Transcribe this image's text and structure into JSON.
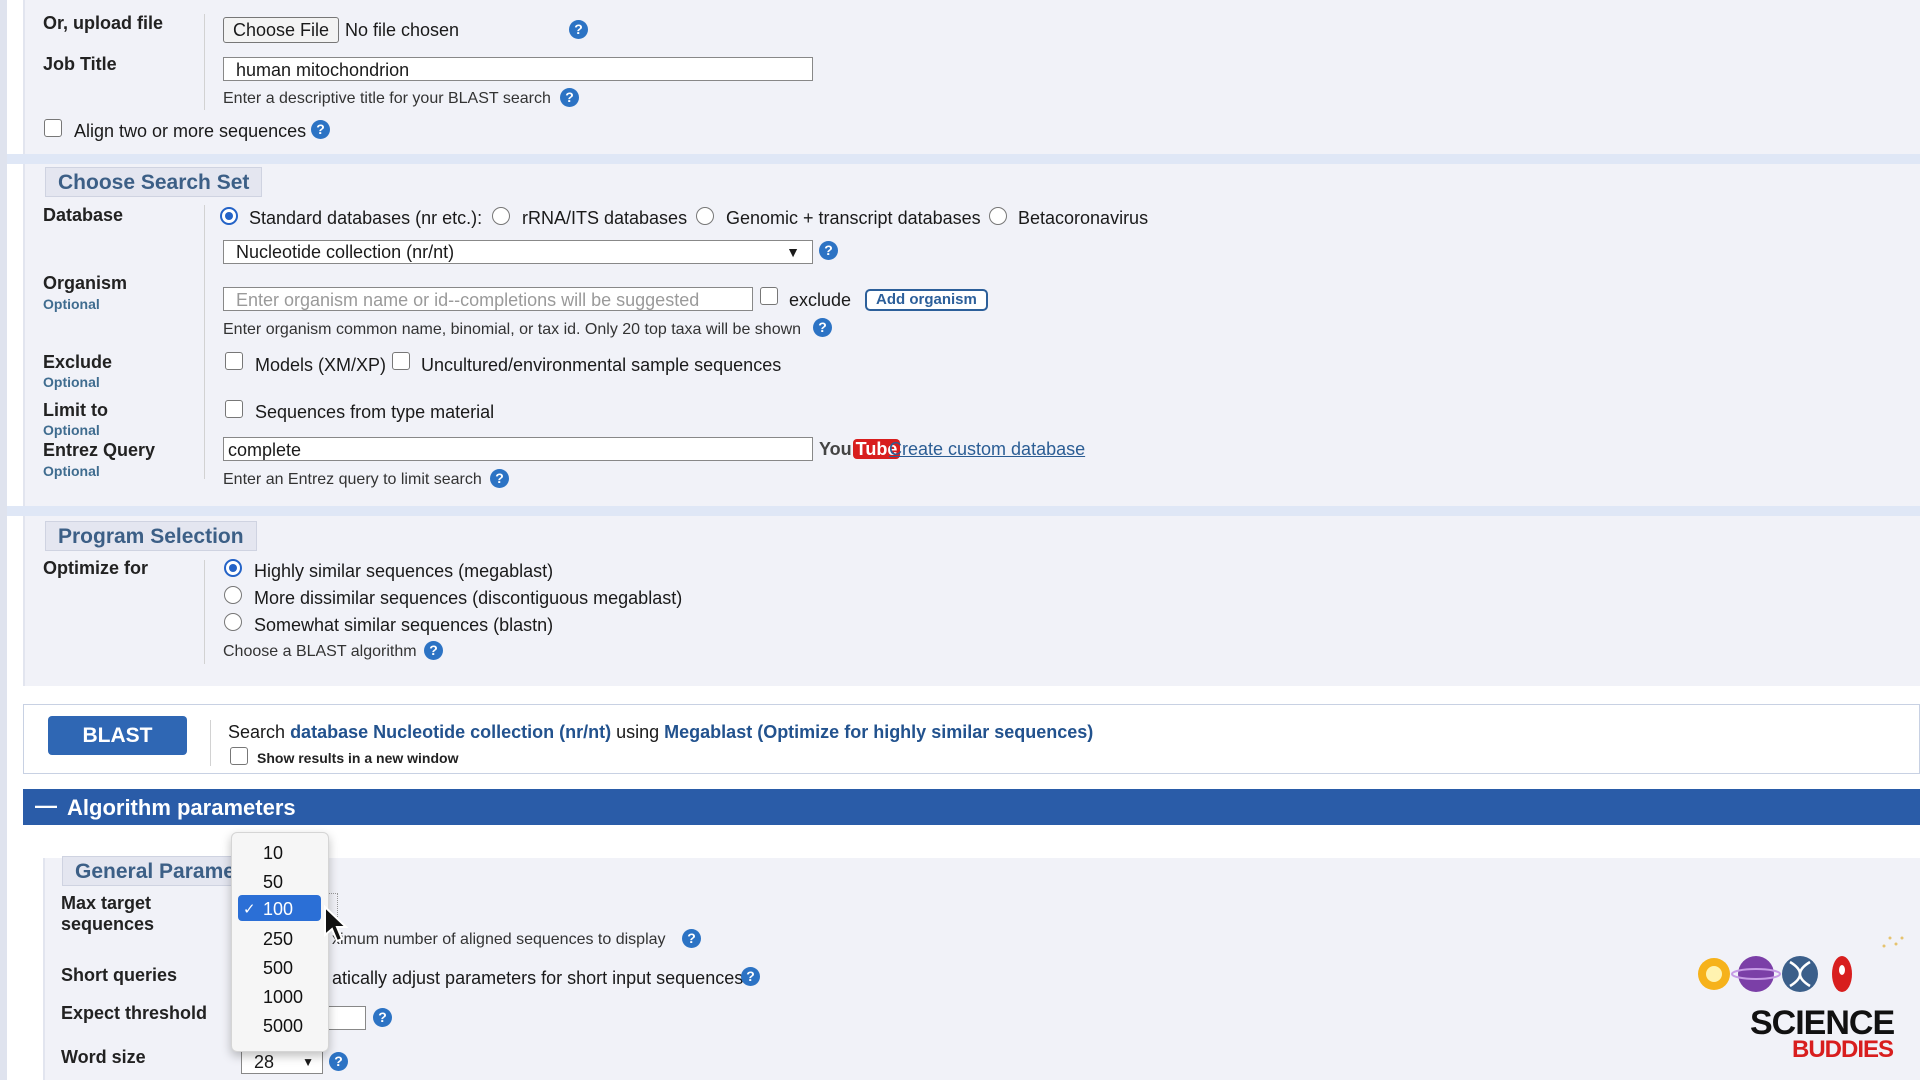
{
  "upload": {
    "label": "Or, upload file",
    "button": "Choose File",
    "status": "No file chosen"
  },
  "job_title": {
    "label": "Job Title",
    "value": "human mitochondrion",
    "hint": "Enter a descriptive title for your BLAST search"
  },
  "align": {
    "label": "Align two or more sequences"
  },
  "search_set": {
    "title": "Choose Search Set",
    "database": {
      "label": "Database",
      "options": [
        "Standard databases (nr etc.):",
        "rRNA/ITS databases",
        "Genomic + transcript databases",
        "Betacoronavirus"
      ],
      "selected": "Nucleotide collection (nr/nt)"
    },
    "organism": {
      "label": "Organism",
      "optional": "Optional",
      "placeholder": "Enter organism name or id--completions will be suggested",
      "exclude_label": "exclude",
      "add_button": "Add organism",
      "hint": "Enter organism common name, binomial, or tax id. Only 20 top taxa will be shown"
    },
    "exclude": {
      "label": "Exclude",
      "optional": "Optional",
      "models": "Models (XM/XP)",
      "uncultured": "Uncultured/environmental sample sequences"
    },
    "limit": {
      "label": "Limit to",
      "optional": "Optional",
      "type_material": "Sequences from type material"
    },
    "entrez": {
      "label": "Entrez Query",
      "optional": "Optional",
      "value": "complete",
      "youtube_you": "You",
      "youtube_tube": "Tube",
      "custom_db_link": "Create custom database",
      "hint": "Enter an Entrez query to limit search"
    }
  },
  "program": {
    "title": "Program Selection",
    "optimize_label": "Optimize for",
    "options": [
      "Highly similar sequences (megablast)",
      "More dissimilar sequences (discontiguous megablast)",
      "Somewhat similar sequences (blastn)"
    ],
    "hint": "Choose a BLAST algorithm"
  },
  "blast": {
    "button": "BLAST",
    "search_prefix": "Search",
    "search_db": "database Nucleotide collection (nr/nt)",
    "search_using": "using",
    "search_algo": "Megablast (Optimize for highly similar sequences)",
    "new_window": "Show results in a new window"
  },
  "algorithm": {
    "toggle": "—",
    "title": "Algorithm parameters",
    "general_title": "General Parame",
    "max_target": {
      "label_line1": "Max target",
      "label_line2": "sequences",
      "hint": "ximum number of aligned sequences to display"
    },
    "short_queries": {
      "label": "Short queries",
      "hint": "atically adjust parameters for short input sequences"
    },
    "expect": {
      "label": "Expect threshold"
    },
    "word_size": {
      "label": "Word size",
      "value": "28"
    }
  },
  "dropdown": {
    "options": [
      "10",
      "50",
      "100",
      "250",
      "500",
      "1000",
      "5000"
    ],
    "selected": "100",
    "check": "✓"
  },
  "logo": {
    "line1": "SCIENCE",
    "line2": "BUDDIES"
  },
  "colors": {
    "accent": "#2a5ca8",
    "section_bg": "#f1f2f8",
    "link": "#2b5d94",
    "logo_red": "#d81e1e"
  }
}
